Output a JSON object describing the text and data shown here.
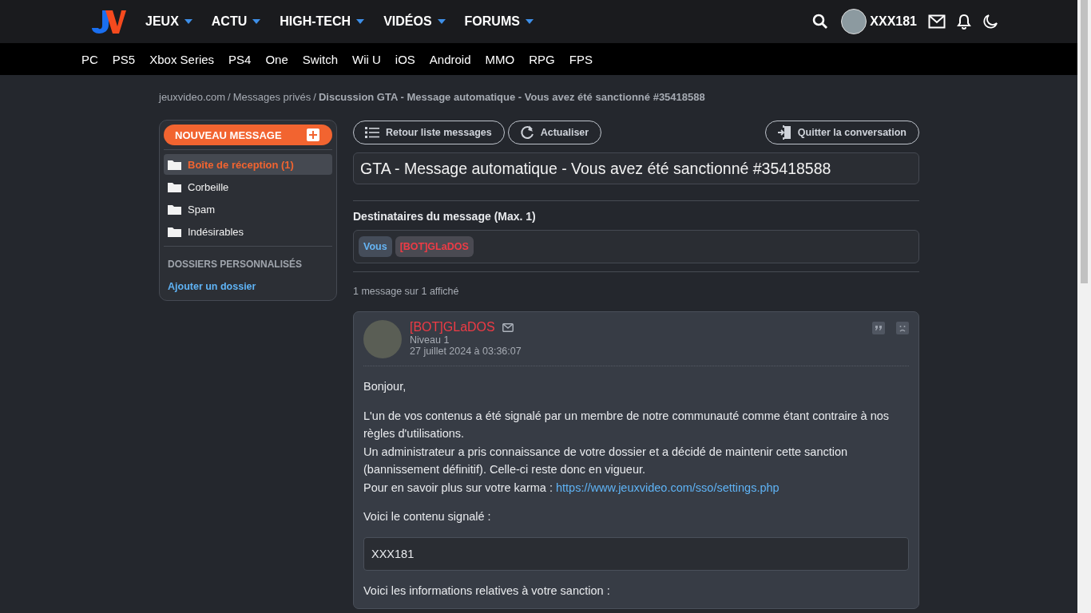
{
  "header": {
    "nav": [
      {
        "label": "JEUX"
      },
      {
        "label": "ACTU"
      },
      {
        "label": "HIGH-TECH"
      },
      {
        "label": "VIDÉOS"
      },
      {
        "label": "FORUMS"
      }
    ],
    "username": "XXX181"
  },
  "subnav": [
    "PC",
    "PS5",
    "Xbox Series",
    "PS4",
    "One",
    "Switch",
    "Wii U",
    "iOS",
    "Android",
    "MMO",
    "RPG",
    "FPS"
  ],
  "breadcrumb": {
    "links": [
      {
        "label": "jeuxvideo.com",
        "separator": "/"
      },
      {
        "label": "Messages privés",
        "separator": "/"
      }
    ],
    "current": "Discussion GTA - Message automatique - Vous avez été sanctionné #35418588"
  },
  "sidebar": {
    "new_message": "NOUVEAU MESSAGE",
    "folders": [
      {
        "label": "Boîte de réception (1)",
        "selected": true
      },
      {
        "label": "Corbeille",
        "selected": false
      },
      {
        "label": "Spam",
        "selected": false
      },
      {
        "label": "Indésirables",
        "selected": false
      }
    ],
    "custom_heading": "DOSSIERS PERSONNALISÉS",
    "add_folder": "Ajouter un dossier"
  },
  "toolbar": {
    "back": "Retour liste messages",
    "refresh": "Actualiser",
    "leave": "Quitter la conversation"
  },
  "subject": "GTA - Message automatique - Vous avez été sanctionné #35418588",
  "recipients": {
    "heading": "Destinataires du message (Max. 1)",
    "items": [
      {
        "label": "Vous",
        "kind": "self"
      },
      {
        "label": "[BOT]GLaDOS",
        "kind": "bot"
      }
    ]
  },
  "count": "1 message sur 1 affiché",
  "message": {
    "author": "[BOT]GLaDOS",
    "level": "Niveau 1",
    "date": "27 juillet 2024 à 03:36:07",
    "body": [
      {
        "kind": "paragraph",
        "lines": [
          {
            "text": "Bonjour,"
          }
        ]
      },
      {
        "kind": "paragraph",
        "lines": [
          {
            "text": "L'un de vos contenus a été signalé par un membre de notre communauté comme étant contraire à nos règles d'utilisations."
          },
          {
            "text": "Un administrateur a pris connaissance de votre dossier et a décidé de maintenir cette sanction (bannissement définitif). Celle-ci reste donc en vigueur."
          },
          {
            "text": "Pour en savoir plus sur votre karma : ",
            "link": "https://www.jeuxvideo.com/sso/settings.php"
          }
        ]
      },
      {
        "kind": "paragraph",
        "lines": [
          {
            "text": "Voici le contenu signalé :"
          }
        ]
      },
      {
        "kind": "quote",
        "lines": [
          {
            "text": "XXX181"
          }
        ]
      },
      {
        "kind": "paragraph",
        "lines": [
          {
            "text": "Voici les informations relatives à votre sanction :"
          }
        ]
      }
    ]
  }
}
